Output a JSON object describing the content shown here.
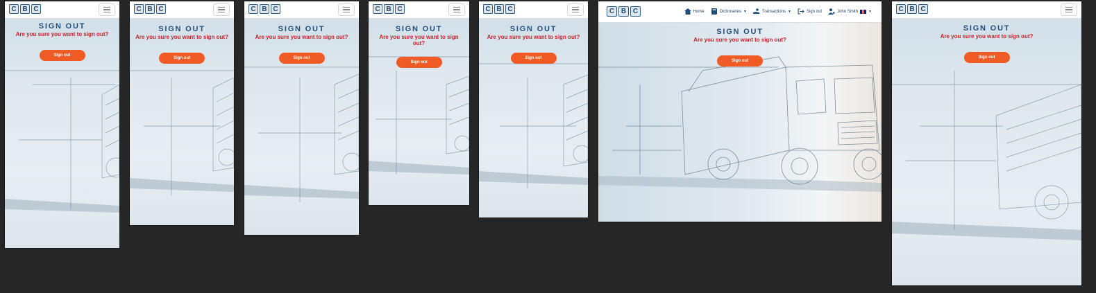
{
  "logo": {
    "letters": [
      "C",
      "B",
      "C"
    ]
  },
  "page": {
    "title": "SIGN OUT",
    "question": "Are you sure you want to sign out?",
    "button_label": "Sign out"
  },
  "nav": {
    "home": "Home",
    "dictionaries": "Dictionaries",
    "transactions": "Transactions",
    "sign_out": "Sign out",
    "user": "John Smith"
  },
  "colors": {
    "page_bg": "#262626",
    "title": "#1f4e79",
    "question": "#c8202a",
    "button": "#f05a24"
  },
  "icons": [
    "hamburger-menu-icon",
    "home-icon",
    "book-icon",
    "hand-icon",
    "sign-out-icon",
    "user-icon",
    "uk-flag-icon",
    "caret-down-icon"
  ]
}
